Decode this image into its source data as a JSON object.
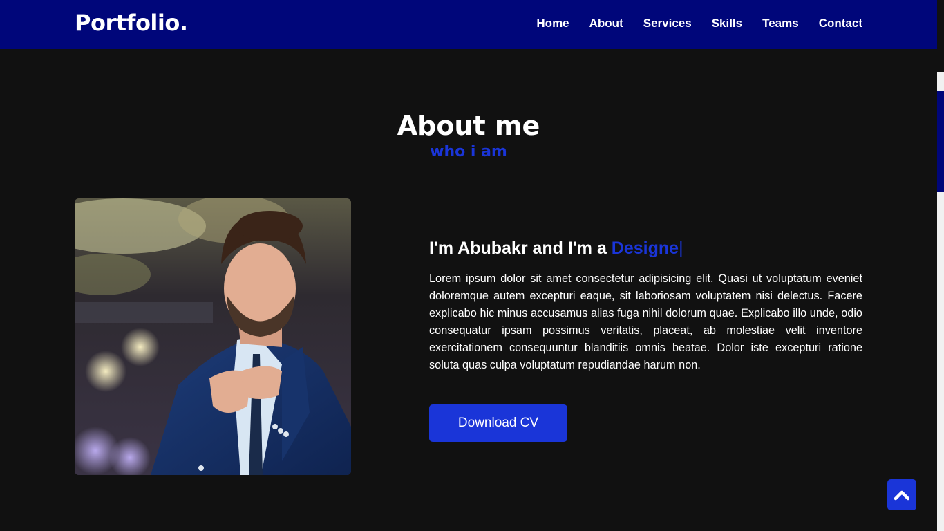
{
  "nav": {
    "logo": "Portfolio.",
    "items": [
      {
        "label": "Home"
      },
      {
        "label": "About"
      },
      {
        "label": "Services"
      },
      {
        "label": "Skills"
      },
      {
        "label": "Teams"
      },
      {
        "label": "Contact"
      }
    ]
  },
  "about": {
    "title": "About me",
    "subtitle": "who i am",
    "photo_alt": "man-in-blue-suit-photo",
    "heading_prefix": "I'm Abubakr and I'm a ",
    "heading_typed": "Designe",
    "heading_cursor": "|",
    "paragraph": "Lorem ipsum dolor sit amet consectetur adipisicing elit. Quasi ut voluptatum eveniet doloremque autem excepturi eaque, sit laboriosam voluptatem nisi delectus. Facere explicabo hic minus accusamus alias fuga nihil dolorum quae. Explicabo illo unde, odio consequatur ipsam possimus veritatis, placeat, ab molestiae velit inventore exercitationem consequuntur blanditiis omnis beatae. Dolor iste excepturi ratione soluta quas culpa voluptatum repudiandae harum non.",
    "cv_button": "Download CV"
  },
  "scroll_top": {
    "icon": "chevron-up-icon"
  },
  "colors": {
    "navbar": "#00067a",
    "background": "#111111",
    "accent": "#1a35d8",
    "text": "#ffffff"
  }
}
